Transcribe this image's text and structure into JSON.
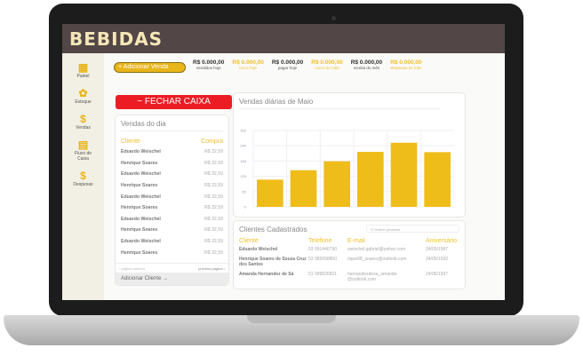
{
  "app": {
    "title": "BEBIDAS"
  },
  "sidebar": {
    "items": [
      {
        "label": "Painel",
        "icon": "grid-icon",
        "glyph": "▦"
      },
      {
        "label": "Estoque",
        "icon": "bottles-icon",
        "glyph": "✿"
      },
      {
        "label": "Vendas",
        "icon": "dollar-coin-icon",
        "glyph": "$"
      },
      {
        "label": "Fluxo de Caixa",
        "icon": "calculator-icon",
        "glyph": "▤"
      },
      {
        "label": "Despesas",
        "icon": "dollar-refresh-icon",
        "glyph": "$"
      }
    ]
  },
  "toolbar": {
    "add_sale": "+ Adicionar Venda"
  },
  "stats": [
    {
      "value": "R$ 0.000,00",
      "label": "vendidos hoje",
      "highlight": false
    },
    {
      "value": "R$ 0.000,00",
      "label": "lucro hoje",
      "highlight": true
    },
    {
      "value": "R$ 0.000,00",
      "label": "pagar hoje",
      "highlight": false
    },
    {
      "value": "R$ 0.000,00",
      "label": "Lucro do mês",
      "highlight": true
    },
    {
      "value": "R$ 0.000,00",
      "label": "receita do mês",
      "highlight": false
    },
    {
      "value": "R$ 0.000,00",
      "label": "despesas do mês",
      "highlight": true
    }
  ],
  "close_cash": "− FECHAR CAIXA",
  "daily_sales": {
    "title": "Vendas do dia",
    "col_client": "Cliente",
    "col_purchase": "Compra",
    "rows": [
      {
        "client": "Eduardo Weischel",
        "amount": "R$ 32,59"
      },
      {
        "client": "Henrique Soares",
        "amount": "R$ 32,59"
      },
      {
        "client": "Eduardo Weischel",
        "amount": "R$ 32,59"
      },
      {
        "client": "Henrique Soares",
        "amount": "R$ 32,59"
      },
      {
        "client": "Eduardo Weischel",
        "amount": "R$ 32,59"
      },
      {
        "client": "Henrique Soares",
        "amount": "R$ 32,59"
      },
      {
        "client": "Eduardo Weischel",
        "amount": "R$ 32,59"
      },
      {
        "client": "Henrique Soares",
        "amount": "R$ 32,59"
      },
      {
        "client": "Eduardo Weischel",
        "amount": "R$ 32,59"
      },
      {
        "client": "Henrique Soares",
        "amount": "R$ 32,59"
      }
    ],
    "prev": "‹ página anterior",
    "next": "próxima página ›",
    "add_client": "Adicionar Cliente →"
  },
  "chart_data": {
    "type": "bar",
    "title": "Vendas diárias de Maio",
    "categories": [
      "1",
      "2",
      "3",
      "4",
      "5",
      "6"
    ],
    "values": [
      107,
      144,
      179,
      216,
      252,
      215
    ],
    "ylim": [
      0,
      300
    ],
    "yticks": [
      "0",
      "60",
      "120",
      "180",
      "240",
      "300"
    ],
    "grid": true,
    "color": "#efbd1a"
  },
  "clients": {
    "title": "Clientes Cadastrados",
    "search_placeholder": "Search products",
    "headers": [
      "Cliente",
      "Telefone",
      "E-mail",
      "Aniversário"
    ],
    "rows": [
      [
        "Eduardo Weischel",
        "53 991446790",
        "weischel.gabriel@yahoo.com",
        "24/05/1987"
      ],
      [
        "Henrique Soares de Souza Cruz dos Santos",
        "53 982658800",
        "rique08_soares@outlook.com",
        "24/05/1992"
      ],
      [
        "Amanda Hernandez de Sá",
        "51 999826831",
        "hernandezdesa_amanda @outlook.com",
        "24/05/1997"
      ]
    ]
  }
}
